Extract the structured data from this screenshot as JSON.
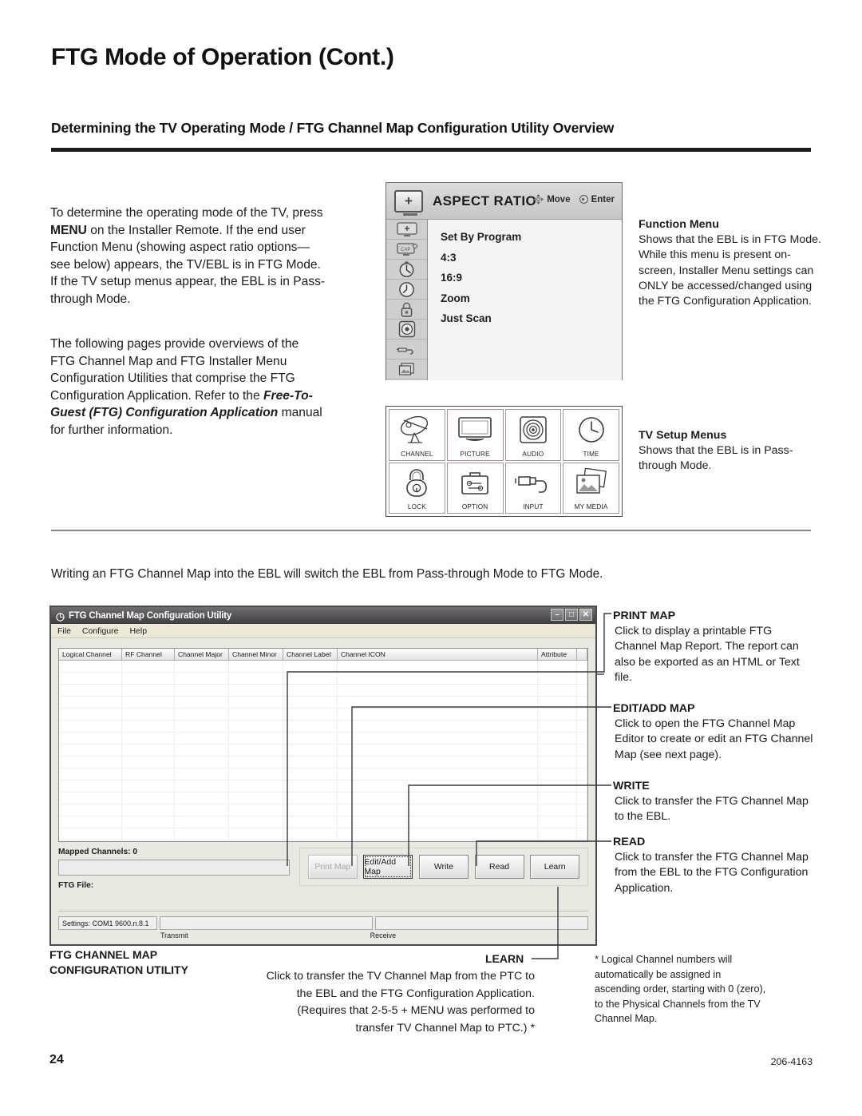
{
  "page": {
    "title": "FTG Mode of Operation (Cont.)",
    "section_heading": "Determining the TV Operating Mode / FTG Channel Map Configuration Utility Overview",
    "page_number": "24",
    "doc_number": "206-4163"
  },
  "intro": {
    "paragraph1_a": "To determine the operating mode of the TV, press ",
    "paragraph1_menu": "MENU",
    "paragraph1_b": " on the Installer Remote. If the end user Function Menu (showing aspect ratio options—see below) appears, the TV/EBL is in FTG Mode. If the TV setup menus appear, the EBL is in Pass-through Mode.",
    "paragraph2_a": "The following pages provide overviews of the FTG Channel Map and FTG Installer Menu Configuration Utilities that comprise the FTG Configuration Application. Refer to the ",
    "paragraph2_italic": "Free-To-Guest (FTG) Configuration Application",
    "paragraph2_b": " manual for further information."
  },
  "aspect_menu": {
    "title": "ASPECT RATIO",
    "hint_move": "Move",
    "hint_enter": "Enter",
    "header_icon": "tv-plus-icon",
    "rail_icons": [
      "tv-picture-icon",
      "tv-caption-icon",
      "stopwatch-icon",
      "clock-icon",
      "lock-icon",
      "target-icon",
      "cable-icon",
      "media-icon"
    ],
    "options": [
      "Set By Program",
      "4:3",
      "16:9",
      "Zoom",
      "Just Scan"
    ]
  },
  "tv_setup_grid": {
    "tiles": [
      {
        "label": "CHANNEL",
        "icon": "satellite-dish-icon",
        "selected": false
      },
      {
        "label": "PICTURE",
        "icon": "monitor-icon",
        "selected": true
      },
      {
        "label": "AUDIO",
        "icon": "speaker-icon",
        "selected": false
      },
      {
        "label": "TIME",
        "icon": "clock-icon",
        "selected": false
      },
      {
        "label": "LOCK",
        "icon": "padlock-icon",
        "selected": false
      },
      {
        "label": "OPTION",
        "icon": "toolbox-icon",
        "selected": false
      },
      {
        "label": "INPUT",
        "icon": "plug-cable-icon",
        "selected": false
      },
      {
        "label": "MY MEDIA",
        "icon": "photos-icon",
        "selected": false
      }
    ]
  },
  "callouts_top": {
    "function_menu": {
      "heading": "Function Menu",
      "body": "Shows that the EBL is in FTG Mode. While this menu is present on-screen, Installer Menu settings can ONLY be accessed/changed using the FTG Configuration Application."
    },
    "tv_setup_menus": {
      "heading": "TV Setup Menus",
      "body": "Shows that the EBL is in Pass-through Mode."
    }
  },
  "mid_line": "Writing an FTG Channel Map into the EBL will switch the EBL from Pass-through Mode to FTG Mode.",
  "app": {
    "title": "FTG Channel Map Configuration Utility",
    "title_icon": "app-logo-icon",
    "window_buttons": {
      "minimize": "–",
      "maximize": "□",
      "close": "✕"
    },
    "menu": [
      "File",
      "Configure",
      "Help"
    ],
    "grid_columns": [
      "Logical Channel",
      "RF Channel",
      "Channel Major",
      "Channel Minor",
      "Channel Label",
      "Channel ICON",
      "Attribute"
    ],
    "mapped_channels_label": "Mapped Channels:",
    "mapped_channels_value": "0",
    "ftg_file_label": "FTG File:",
    "buttons": [
      {
        "label": "Print Map",
        "underline": "P",
        "state": "disabled"
      },
      {
        "label": "Edit/Add Map",
        "underline": "E",
        "state": "focused"
      },
      {
        "label": "Write",
        "underline": "W",
        "state": "normal"
      },
      {
        "label": "Read",
        "underline": "R",
        "state": "normal"
      },
      {
        "label": "Learn",
        "underline": "L",
        "state": "normal"
      }
    ],
    "status": {
      "settings": "Settings: COM1 9600.n.8.1",
      "transmit_caption": "Transmit",
      "receive_caption": "Receive"
    }
  },
  "callouts_bottom": {
    "print_map": {
      "heading": "PRINT MAP",
      "body": "Click to display a printable FTG Channel Map Report. The report can also be exported as an HTML or Text file."
    },
    "edit_add_map": {
      "heading": "EDIT/ADD MAP",
      "body": "Click to open the FTG Channel Map Editor to create or edit an FTG Channel Map (see next page)."
    },
    "write": {
      "heading": "WRITE",
      "body": "Click to transfer the FTG Channel Map to the EBL."
    },
    "read": {
      "heading": "READ",
      "body": "Click to transfer the FTG Channel Map from the EBL to the FTG Configuration Application."
    },
    "utility_label_line1": "FTG CHANNEL MAP",
    "utility_label_line2": "CONFIGURATION UTILITY",
    "learn": {
      "heading": "LEARN",
      "body": "Click to transfer the TV Channel Map from the PTC to the EBL and the FTG Configuration Application. (Requires that 2-5-5 + MENU was performed to transfer TV Channel Map to PTC.) *"
    },
    "footnote": "* Logical Channel numbers will automatically be assigned in ascending order, starting with 0 (zero), to the Physical Channels from the TV Channel Map."
  }
}
